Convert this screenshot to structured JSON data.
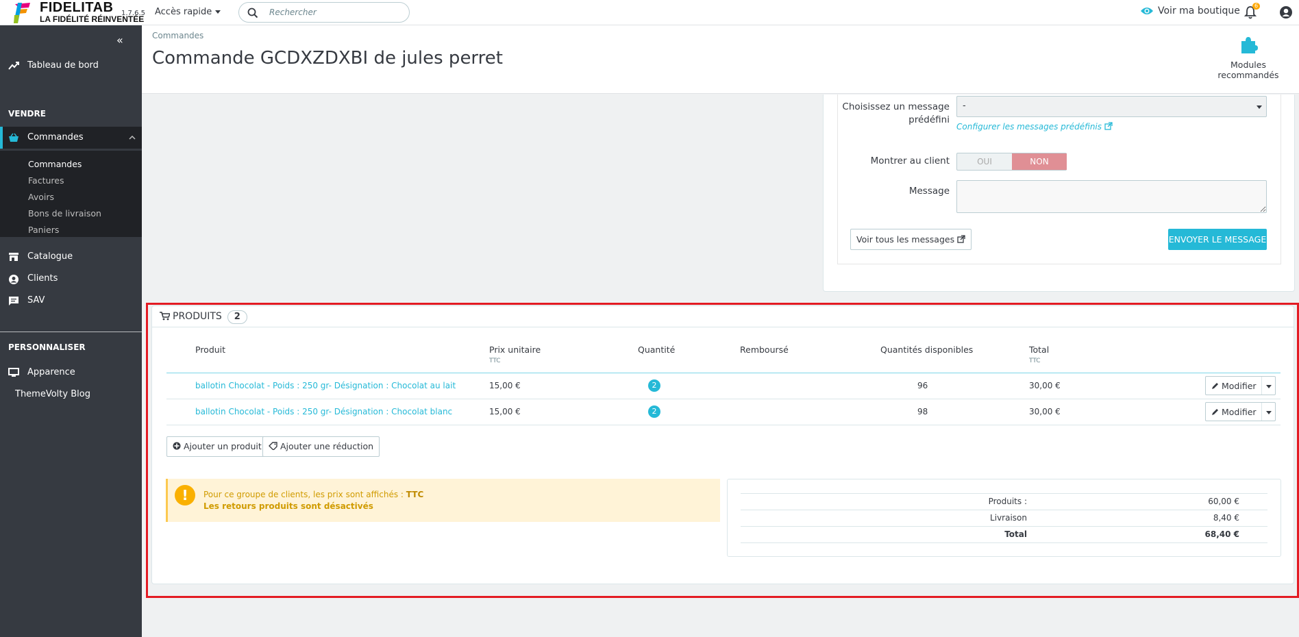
{
  "topbar": {
    "brand_line1": "FIDELITAB",
    "brand_line2": "LA FIDÉLITÉ RÉINVENTÉE",
    "version": "1.7.6.5",
    "quick_access": "Accès rapide",
    "search_placeholder": "Rechercher",
    "view_shop": "Voir ma boutique",
    "notifications_count": "6"
  },
  "sidebar": {
    "dashboard": "Tableau de bord",
    "section_sell": "VENDRE",
    "orders": "Commandes",
    "sub": [
      "Commandes",
      "Factures",
      "Avoirs",
      "Bons de livraison",
      "Paniers"
    ],
    "catalog": "Catalogue",
    "clients": "Clients",
    "sav": "SAV",
    "section_customize": "PERSONNALISER",
    "appearance": "Apparence",
    "themevolty": "ThemeVolty Blog"
  },
  "header": {
    "breadcrumb": "Commandes",
    "title": "Commande GCDXZDXBI de jules perret",
    "modules_recommended": "Modules recommandés"
  },
  "message_form": {
    "choose_label_1": "Choisissez un message",
    "choose_label_2": "prédéfini",
    "select_value": "-",
    "configure_link": "Configurer les messages prédéfinis",
    "show_client_label": "Montrer au client",
    "toggle_yes": "OUI",
    "toggle_no": "NON",
    "message_label": "Message",
    "view_all_button": "Voir tous les messages",
    "send_button": "ENVOYER LE MESSAGE"
  },
  "products": {
    "title": "PRODUITS",
    "count": "2",
    "columns": {
      "product": "Produit",
      "unit_price": "Prix unitaire",
      "unit_price_sub": "TTC",
      "quantity": "Quantité",
      "refunded": "Remboursé",
      "available": "Quantités disponibles",
      "total": "Total",
      "total_sub": "TTC"
    },
    "rows": [
      {
        "name": "ballotin Chocolat - Poids : 250 gr- Désignation : Chocolat au lait",
        "unit_price": "15,00 €",
        "quantity": "2",
        "available": "96",
        "total": "30,00 €",
        "action": "Modifier"
      },
      {
        "name": "ballotin Chocolat - Poids : 250 gr- Désignation : Chocolat blanc",
        "unit_price": "15,00 €",
        "quantity": "2",
        "available": "98",
        "total": "30,00 €",
        "action": "Modifier"
      }
    ],
    "add_product": "Ajouter un produit",
    "add_discount": "Ajouter une réduction",
    "alert_text": "Pour ce groupe de clients, les prix sont affichés :",
    "alert_strong": "TTC",
    "alert_returns": "Les retours produits sont désactivés",
    "totals": [
      {
        "label": "Produits :",
        "value": "60,00 €"
      },
      {
        "label": "Livraison",
        "value": "8,40 €"
      },
      {
        "label": "Total",
        "value": "68,40 €"
      }
    ]
  },
  "colors": {
    "accent": "#25b9d7",
    "sidebar": "#363a41",
    "highlight_border": "#e31b23",
    "toggle_no": "#e08f95",
    "alert_bg": "#fff3d7"
  }
}
